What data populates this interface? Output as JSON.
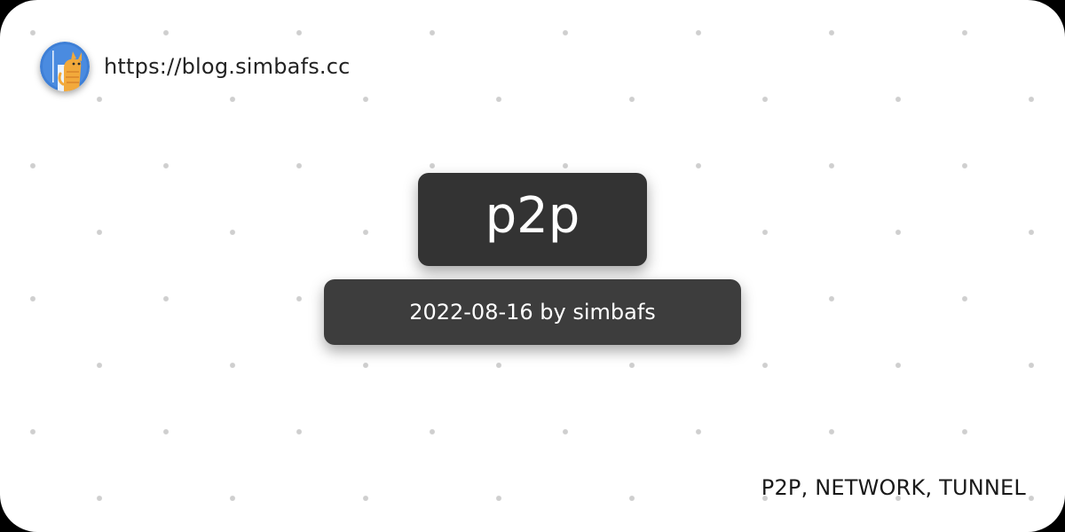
{
  "site": {
    "url": "https://blog.simbafs.cc",
    "avatar_icon": "cat-avatar-icon"
  },
  "post": {
    "title": "p2p",
    "meta": "2022-08-16 by simbafs",
    "tags": "P2P, NETWORK, TUNNEL"
  },
  "colors": {
    "card_background": "#ffffff",
    "dot": "#cfcfcf",
    "title_box": "#333333",
    "meta_box": "#3d3d3d",
    "avatar_background": "#3e7fd6",
    "cat": "#f2a93b"
  }
}
